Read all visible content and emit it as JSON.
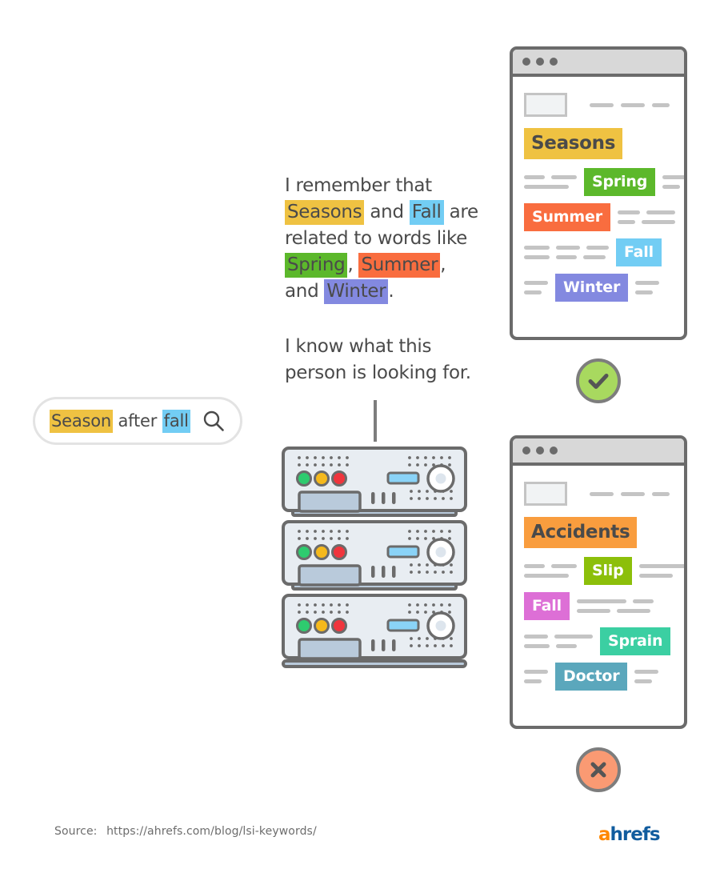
{
  "search": {
    "query_parts": [
      {
        "text": "Season",
        "highlight": "yellow"
      },
      {
        "text": " after ",
        "highlight": "none"
      },
      {
        "text": "fall",
        "highlight": "skyblue"
      }
    ],
    "plain_query": "Season after fall",
    "icon": "search-icon"
  },
  "narrative": {
    "paragraph_1": {
      "segments": [
        {
          "text": "I remember that ",
          "highlight": "none"
        },
        {
          "text": "Seasons",
          "highlight": "yellow"
        },
        {
          "text": " and ",
          "highlight": "none"
        },
        {
          "text": "Fall",
          "highlight": "skyblue"
        },
        {
          "text": " are related to words like ",
          "highlight": "none"
        },
        {
          "text": "Spring",
          "highlight": "green"
        },
        {
          "text": ", ",
          "highlight": "none"
        },
        {
          "text": "Summer",
          "highlight": "orange"
        },
        {
          "text": ", and ",
          "highlight": "none"
        },
        {
          "text": "Winter",
          "highlight": "purple"
        },
        {
          "text": ".",
          "highlight": "none"
        }
      ],
      "plain_text": "I remember that Seasons and Fall are related to words like Spring, Summer, and Winter."
    },
    "paragraph_2": {
      "plain_text": "I know what this person is looking for."
    }
  },
  "browser_windows": [
    {
      "id": "seasons",
      "status": "approved",
      "title_chip": {
        "label": "Seasons",
        "bg": "#efc242",
        "text_color": "#4a4a4a"
      },
      "rows": [
        {
          "label": "Spring",
          "bg": "#5cb82b",
          "position": "center",
          "dashes_left": [
            [
              26,
              32
            ],
            [
              56
            ]
          ],
          "dashes_right": [
            [
              36
            ],
            [
              22
            ]
          ]
        },
        {
          "label": "Summer",
          "bg": "#f96d3f",
          "position": "left",
          "dashes_left": [],
          "dashes_right": [
            [
              28,
              36
            ],
            [
              22,
              42
            ]
          ]
        },
        {
          "label": "Fall",
          "bg": "#72cdf4",
          "position": "right",
          "dashes_left": [
            [
              32,
              30,
              28
            ],
            [
              32,
              26,
              28
            ]
          ],
          "dashes_right": []
        },
        {
          "label": "Winter",
          "bg": "#8389e0",
          "position": "center",
          "dashes_left": [
            [
              30
            ],
            [
              22
            ]
          ],
          "dashes_right": [
            [
              30
            ],
            [
              22
            ]
          ]
        }
      ]
    },
    {
      "id": "accidents",
      "status": "rejected",
      "title_chip": {
        "label": "Accidents",
        "bg": "#f99d3e",
        "text_color": "#4a4a4a"
      },
      "rows": [
        {
          "label": "Slip",
          "bg": "#8cbf0a",
          "position": "center",
          "dashes_left": [
            [
              26,
              32
            ],
            [
              56
            ]
          ],
          "dashes_right": [
            [
              58
            ],
            [
              42
            ]
          ]
        },
        {
          "label": "Fall",
          "bg": "#dd6fd6",
          "position": "left",
          "dashes_left": [],
          "dashes_right": [
            [
              62,
              26
            ],
            [
              42,
              42
            ]
          ]
        },
        {
          "label": "Sprain",
          "bg": "#3bcfa2",
          "position": "right",
          "dashes_left": [
            [
              30,
              48
            ],
            [
              32,
              26
            ]
          ],
          "dashes_right": []
        },
        {
          "label": "Doctor",
          "bg": "#5ba7bc",
          "position": "center",
          "dashes_left": [
            [
              30
            ],
            [
              22
            ]
          ],
          "dashes_right": [
            [
              30
            ],
            [
              22
            ]
          ]
        }
      ]
    }
  ],
  "status_badges": {
    "approved": {
      "icon": "check-icon",
      "bg": "#a8d95f",
      "border": "#7d7d7d"
    },
    "rejected": {
      "icon": "close-icon",
      "bg": "#fa9a73",
      "border": "#7d7d7d"
    }
  },
  "server_rack": {
    "icon": "server-rack-icon",
    "unit_count": 3,
    "leds": [
      {
        "name": "status-led-green",
        "color": "#2ecb6f"
      },
      {
        "name": "status-led-yellow",
        "color": "#f5b91c"
      },
      {
        "name": "status-led-red",
        "color": "#f0353d"
      }
    ],
    "display_color": "#8ad3f7",
    "panel_color": "#e8edf2",
    "outline_color": "#6b6b6b"
  },
  "footer": {
    "source_label": "Source:",
    "source_url": "https://ahrefs.com/blog/lsi-keywords/",
    "logo": {
      "accent_letter": "a",
      "rest": "hrefs",
      "accent_color": "#ff8800",
      "text_color": "#115c9e"
    }
  },
  "palette": {
    "yellow": "#efc242",
    "skyblue": "#72cdf4",
    "green": "#5cb82b",
    "orange": "#f96d3f",
    "purple": "#8389e0",
    "olive": "#8cbf0a",
    "magenta": "#dd6fd6",
    "mint": "#3bcfa2",
    "steel": "#5ba7bc",
    "amber": "#f99d3e",
    "gray_text": "#4a4a4a",
    "gray_line": "#c4c4c4",
    "frame": "#6b6b6b"
  }
}
